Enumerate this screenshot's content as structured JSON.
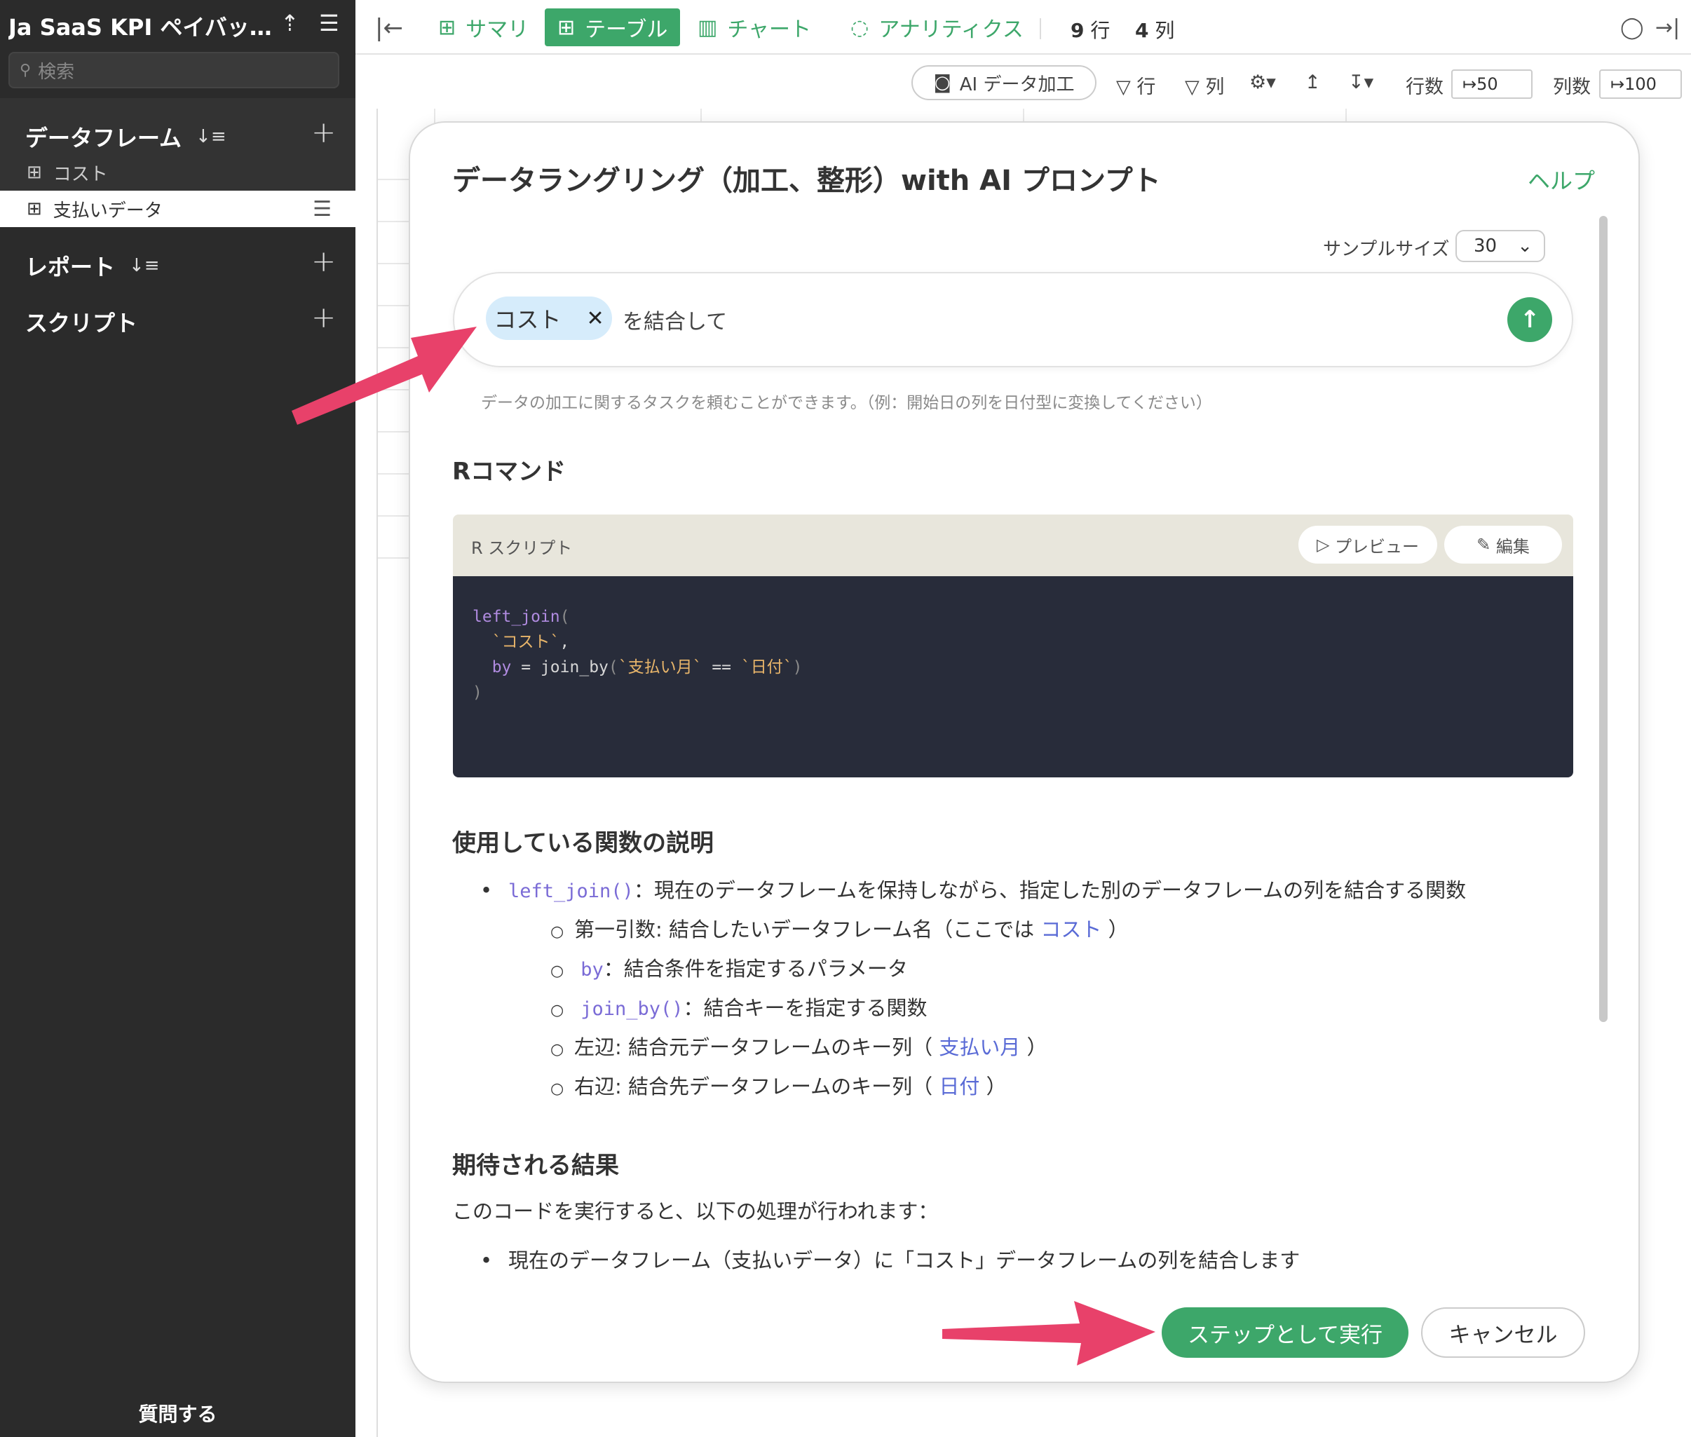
{
  "sidebar": {
    "title": "Ja SaaS KPI ペイバック…",
    "upload_icon": "upload-icon",
    "menu_icon": "hamburger-icon",
    "search_placeholder": "検索",
    "sections": {
      "dataframe": "データフレーム",
      "report": "レポート",
      "script": "スクリプト"
    },
    "items": [
      {
        "label": "コスト",
        "active": false
      },
      {
        "label": "支払いデータ",
        "active": true
      }
    ],
    "ask": "質問する"
  },
  "topbar": {
    "tabs": [
      {
        "label": "サマリ",
        "icon": "grid-icon"
      },
      {
        "label": "テーブル",
        "icon": "table-icon",
        "active": true
      },
      {
        "label": "チャート",
        "icon": "bar-chart-icon"
      },
      {
        "label": "アナリティクス",
        "icon": "lightbulb-icon"
      }
    ],
    "rows_count": "9",
    "rows_unit": "行",
    "cols_count": "4",
    "cols_unit": "列"
  },
  "toolbar": {
    "ai_button": "AI データ加工",
    "filter_rows": "行",
    "filter_cols": "列",
    "rows_label": "行数",
    "rows_value": "50",
    "cols_label": "列数",
    "cols_value": "100"
  },
  "modal": {
    "title": "データラングリング（加工、整形）with AI プロンプト",
    "help": "ヘルプ",
    "sample_label": "サンプルサイズ",
    "sample_value": "30",
    "chip": "コスト",
    "prompt_text": "を結合して",
    "hint": "データの加工に関するタスクを頼むことができます。（例：開始日の列を日付型に変換してください）",
    "r_heading": "Rコマンド",
    "code_label": "R スクリプト",
    "preview": "プレビュー",
    "edit": "編集",
    "code": {
      "fn": "left_join",
      "arg_df": "`コスト`",
      "by_kw": "by",
      "join_fn": "join_by",
      "left_key": "`支払い月`",
      "op": "==",
      "right_key": "`日付`"
    },
    "func_heading": "使用している関数の説明",
    "func_items": {
      "main_code": "left_join()",
      "main_text": "：現在のデータフレームを保持しながら、指定した別のデータフレームの列を結合する関数",
      "sub1_pre": "第一引数: 結合したいデータフレーム名（ここでは ",
      "sub1_link": "コスト",
      "sub1_post": " ）",
      "sub2_code": "by",
      "sub2_text": "：結合条件を指定するパラメータ",
      "sub3_code": "join_by()",
      "sub3_text": "：結合キーを指定する関数",
      "sub4_pre": "左辺: 結合元データフレームのキー列（ ",
      "sub4_link": "支払い月",
      "sub4_post": " ）",
      "sub5_pre": "右辺: 結合先データフレームのキー列（ ",
      "sub5_link": "日付",
      "sub5_post": " ）"
    },
    "result_heading": "期待される結果",
    "result_text": "このコードを実行すると、以下の処理が行われます：",
    "result_bullet": "現在のデータフレーム（支払いデータ）に「コスト」データフレームの列を結合します",
    "run_button": "ステップとして実行",
    "cancel_button": "キャンセル"
  },
  "annotation_color": "#e8416a",
  "accent_color": "#3da76a"
}
